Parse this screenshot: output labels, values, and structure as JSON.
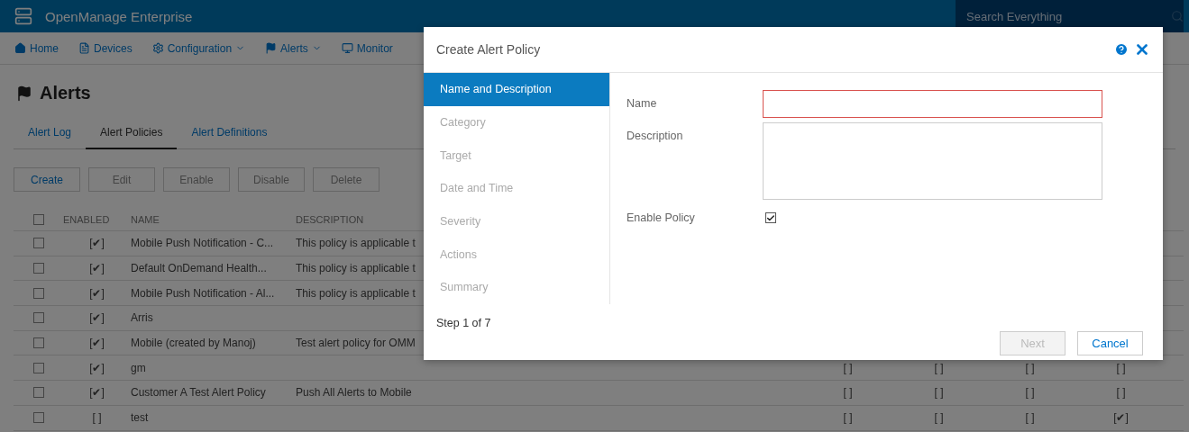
{
  "app": {
    "title": "OpenManage Enterprise",
    "search": {
      "placeholder": "Search Everything"
    }
  },
  "nav": [
    {
      "label": "Home",
      "kind": "home",
      "dropdown": false
    },
    {
      "label": "Devices",
      "kind": "devices",
      "dropdown": false
    },
    {
      "label": "Configuration",
      "kind": "configuration",
      "dropdown": true
    },
    {
      "label": "Alerts",
      "kind": "alerts",
      "dropdown": true
    },
    {
      "label": "Monitor",
      "kind": "monitor",
      "dropdown": false
    }
  ],
  "page": {
    "title": "Alerts"
  },
  "tabs": [
    {
      "label": "Alert Log",
      "selected": false
    },
    {
      "label": "Alert Policies",
      "selected": true
    },
    {
      "label": "Alert Definitions",
      "selected": false
    }
  ],
  "actions": [
    {
      "label": "Create",
      "disabled": false
    },
    {
      "label": "Edit",
      "disabled": true
    },
    {
      "label": "Enable",
      "disabled": true
    },
    {
      "label": "Disable",
      "disabled": true
    },
    {
      "label": "Delete",
      "disabled": true
    }
  ],
  "table": {
    "all_checked": false,
    "columns": [
      "ENABLED",
      "NAME",
      "DESCRIPTION"
    ],
    "rows": [
      {
        "checked": false,
        "enabled": "[✔]",
        "name": "Mobile Push Notification - C...",
        "description": "This policy is applicable t"
      },
      {
        "checked": false,
        "enabled": "[✔]",
        "name": "Default OnDemand Health...",
        "description": "This policy is applicable t"
      },
      {
        "checked": false,
        "enabled": "[✔]",
        "name": "Mobile Push Notification - Al...",
        "description": "This policy is applicable t"
      },
      {
        "checked": false,
        "enabled": "[✔]",
        "name": "Arris"
      },
      {
        "checked": false,
        "enabled": "[✔]",
        "name": "Mobile (created by Manoj)",
        "description": "Test alert policy for OMM"
      },
      {
        "checked": false,
        "enabled": "[✔]",
        "name": "gm",
        "flags": [
          "[ ]",
          "[ ]",
          "[ ]",
          "[ ]"
        ]
      },
      {
        "checked": false,
        "enabled": "[✔]",
        "name": "Customer A Test Alert Policy",
        "description": "Push All Alerts to Mobile",
        "flags": [
          "[ ]",
          "[ ]",
          "[ ]",
          "[ ]"
        ]
      },
      {
        "checked": false,
        "enabled": "[ ]",
        "name": "test",
        "flags": [
          "[ ]",
          "[ ]",
          "[ ]",
          "[✔]"
        ]
      }
    ]
  },
  "dialog": {
    "title": "Create Alert Policy",
    "steps": [
      {
        "label": "Name and Description",
        "selected": true
      },
      {
        "label": "Category",
        "selected": false
      },
      {
        "label": "Target",
        "selected": false
      },
      {
        "label": "Date and Time",
        "selected": false
      },
      {
        "label": "Severity",
        "selected": false
      },
      {
        "label": "Actions",
        "selected": false
      },
      {
        "label": "Summary",
        "selected": false
      }
    ],
    "step_text": "Step 1 of 7",
    "fields": [
      {
        "label": "Name",
        "kind": "text",
        "invalid": true
      },
      {
        "label": "Description",
        "kind": "textarea",
        "invalid": false
      },
      {
        "label": "Enable Policy",
        "kind": "checkbox",
        "checked": true
      }
    ],
    "buttons": [
      {
        "label": "Next",
        "disabled": true
      },
      {
        "label": "Cancel",
        "disabled": false
      }
    ]
  }
}
